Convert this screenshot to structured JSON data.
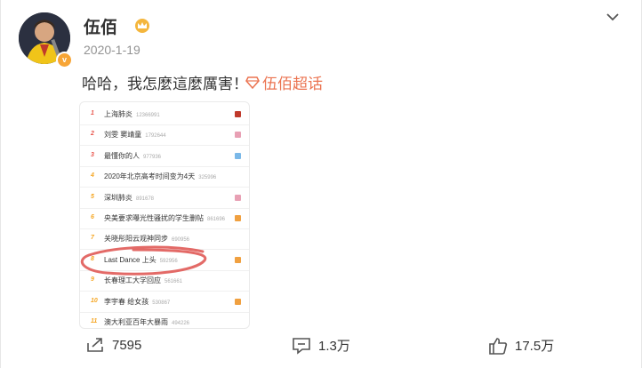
{
  "user": {
    "name": "伍佰",
    "vip_badge": "v"
  },
  "post": {
    "date": "2020-1-19",
    "text": "哈哈，我怎麼這麼厲害！",
    "topic": "伍佰超话"
  },
  "hotlist": [
    {
      "rank": "1",
      "title": "上海肺炎",
      "count": "12366991",
      "badge_color": "#c0392b"
    },
    {
      "rank": "2",
      "title": "刘雯 窦靖童",
      "count": "1792644",
      "badge_color": "#e8a0b4"
    },
    {
      "rank": "3",
      "title": "最懂你的人",
      "count": "977936",
      "badge_color": "#7ab8e8"
    },
    {
      "rank": "4",
      "title": "2020年北京高考时间变为4天",
      "count": "325996",
      "badge_color": ""
    },
    {
      "rank": "5",
      "title": "深圳肺炎",
      "count": "891678",
      "badge_color": "#e8a0b4"
    },
    {
      "rank": "6",
      "title": "央美要求曝光性骚扰的学生删帖",
      "count": "861696",
      "badge_color": "#f0a040"
    },
    {
      "rank": "7",
      "title": "关晓彤阳云观神同步",
      "count": "690956",
      "badge_color": ""
    },
    {
      "rank": "8",
      "title": "Last Dance 上头",
      "count": "592956",
      "badge_color": "#f0a040"
    },
    {
      "rank": "9",
      "title": "长春理工大学回应",
      "count": "561661",
      "badge_color": ""
    },
    {
      "rank": "10",
      "title": "李宇春 给女孩",
      "count": "530867",
      "badge_color": "#f0a040"
    },
    {
      "rank": "11",
      "title": "澳大利亚百年大暴雨",
      "count": "494226",
      "badge_color": ""
    }
  ],
  "actions": {
    "repost": "7595",
    "comment": "1.3万",
    "like": "17.5万"
  },
  "colors": {
    "accent": "#eb7350",
    "rank_top": "#e8534a",
    "rank_rest": "#f5a623"
  }
}
